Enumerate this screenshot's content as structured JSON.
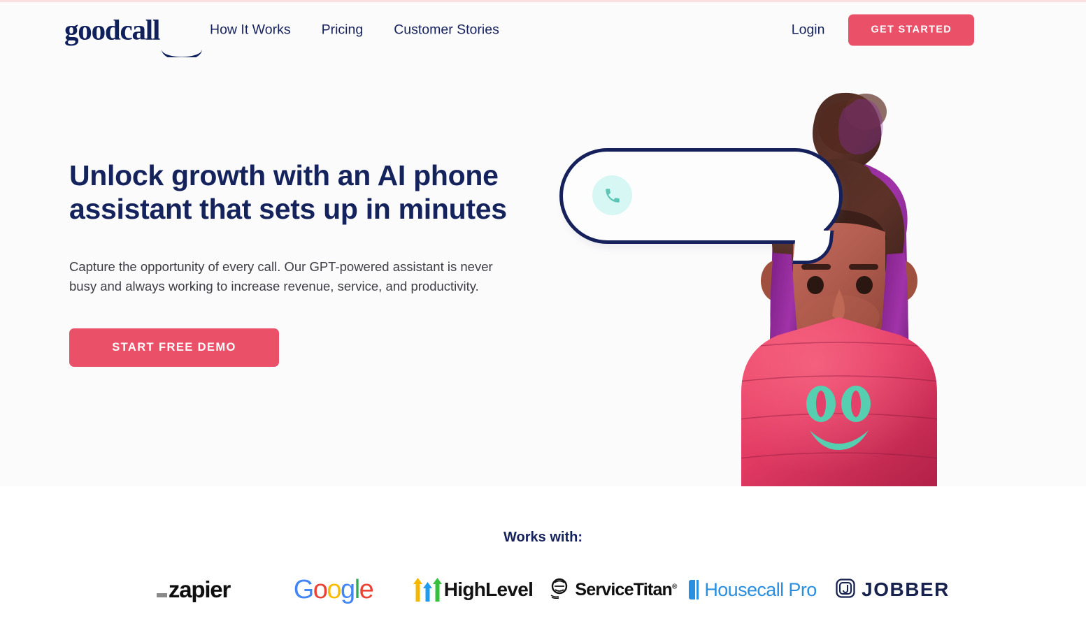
{
  "brand": {
    "name": "goodcall",
    "accent_pink": "#ea5068",
    "navy": "#16225c",
    "mint": "#d6f7f4",
    "teal": "#4fc4b4"
  },
  "header": {
    "logo_text": "goodcall",
    "nav": [
      {
        "label": "How It Works"
      },
      {
        "label": "Pricing"
      },
      {
        "label": "Customer Stories"
      }
    ],
    "login_label": "Login",
    "cta_label": "GET STARTED"
  },
  "hero": {
    "title": "Unlock growth with an AI phone assistant that sets up in minutes",
    "subtitle": "Capture the opportunity of every call. Our GPT-powered assistant is never busy and always working to increase revenue, service, and productivity.",
    "cta_label": "START FREE DEMO",
    "illustration": {
      "bubble_icon": "phone-icon",
      "bubble_text": "",
      "character": "3d-avatar-woman-with-pink-shirt",
      "shirt_logo": "goodcall-smiley-icon"
    }
  },
  "works_with": {
    "label": "Works with:",
    "logos": [
      {
        "name": "zapier",
        "text": "zapier"
      },
      {
        "name": "google",
        "text": "Google"
      },
      {
        "name": "highlevel",
        "text": "HighLevel"
      },
      {
        "name": "servicetitan",
        "text": "ServiceTitan"
      },
      {
        "name": "housecall-pro",
        "text": "Housecall Pro"
      },
      {
        "name": "jobber",
        "text": "JOBBER"
      }
    ]
  }
}
